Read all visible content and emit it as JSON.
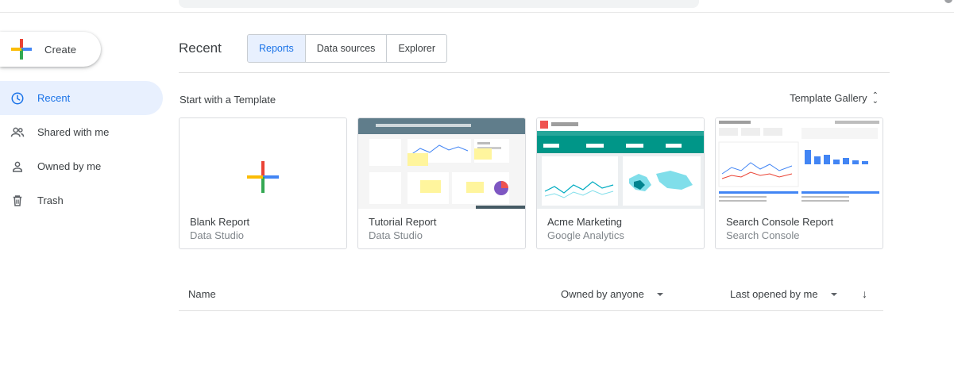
{
  "sidebar": {
    "create_label": "Create",
    "items": [
      {
        "label": "Recent",
        "icon": "clock-icon",
        "active": true
      },
      {
        "label": "Shared with me",
        "icon": "people-icon",
        "active": false
      },
      {
        "label": "Owned by me",
        "icon": "person-icon",
        "active": false
      },
      {
        "label": "Trash",
        "icon": "trash-icon",
        "active": false
      }
    ]
  },
  "main": {
    "title": "Recent",
    "tabs": [
      {
        "label": "Reports",
        "active": true
      },
      {
        "label": "Data sources",
        "active": false
      },
      {
        "label": "Explorer",
        "active": false
      }
    ],
    "template_section_title": "Start with a Template",
    "template_gallery_label": "Template Gallery",
    "templates": [
      {
        "title": "Blank Report",
        "subtitle": "Data Studio"
      },
      {
        "title": "Tutorial Report",
        "subtitle": "Data Studio"
      },
      {
        "title": "Acme Marketing",
        "subtitle": "Google Analytics"
      },
      {
        "title": "Search Console Report",
        "subtitle": "Search Console"
      }
    ],
    "list_header": {
      "name_label": "Name",
      "owner_filter": "Owned by anyone",
      "sort_label": "Last opened by me"
    }
  },
  "colors": {
    "accent": "#1a73e8",
    "active_bg": "#e8f0fe",
    "plus_red": "#ea4335",
    "plus_blue": "#4285f4",
    "plus_green": "#34a853",
    "plus_yellow": "#fbbc05"
  }
}
